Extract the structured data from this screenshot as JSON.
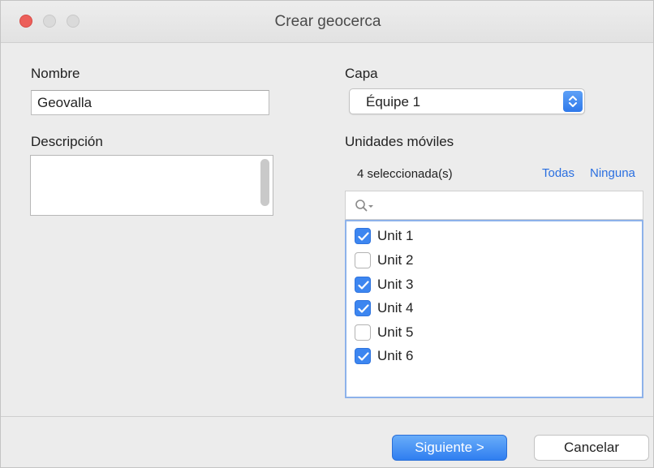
{
  "window": {
    "title": "Crear geocerca"
  },
  "form": {
    "name_label": "Nombre",
    "name_value": "Geovalla",
    "description_label": "Descripción",
    "description_value": "",
    "layer_label": "Capa",
    "layer_value": "Équipe 1",
    "units_label": "Unidades móviles",
    "selected_count": "4 seleccionada(s)",
    "select_all_label": "Todas",
    "select_none_label": "Ninguna",
    "search_value": "",
    "units": [
      {
        "label": "Unit 1",
        "checked": true
      },
      {
        "label": "Unit 2",
        "checked": false
      },
      {
        "label": "Unit 3",
        "checked": true
      },
      {
        "label": "Unit 4",
        "checked": true
      },
      {
        "label": "Unit 5",
        "checked": false
      },
      {
        "label": "Unit 6",
        "checked": true
      }
    ]
  },
  "footer": {
    "next_label": "Siguiente >",
    "cancel_label": "Cancelar"
  },
  "colors": {
    "accent": "#3d86f0",
    "close_button": "#ec5f5a",
    "link": "#2a6fe0"
  },
  "icons": {
    "search": "magnifier-icon",
    "checkbox_check": "checkmark-icon",
    "select_arrows": "updown-chevron-icon"
  }
}
